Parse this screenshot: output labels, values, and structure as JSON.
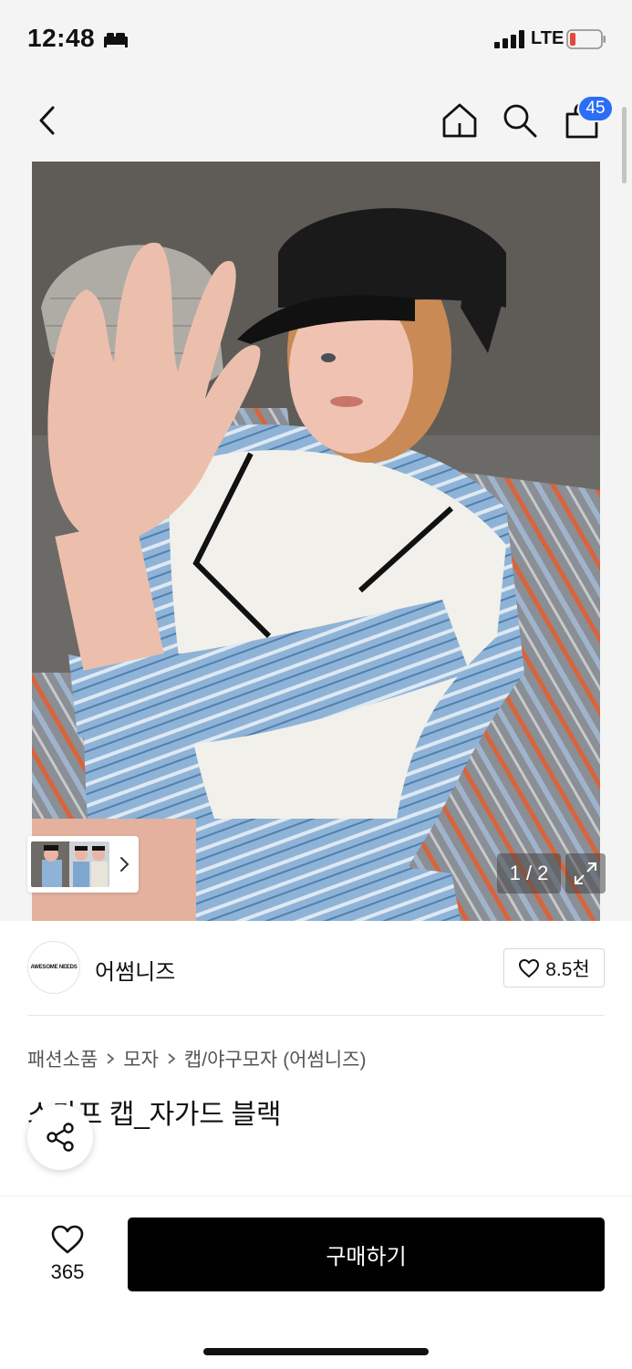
{
  "status_bar": {
    "time": "12:48",
    "network": "LTE",
    "icons": [
      "sleep-icon",
      "signal-icon",
      "battery-low-icon"
    ]
  },
  "header": {
    "icons": [
      "back-arrow-icon",
      "home-icon",
      "search-icon",
      "shopping-bag-icon"
    ],
    "cart_count": "45"
  },
  "gallery": {
    "page_indicator": "1 / 2",
    "icons": [
      "expand-icon",
      "chevron-right-icon"
    ]
  },
  "brand": {
    "logo_text": "AWESOME NEEDS",
    "name": "어썸니즈",
    "like_count": "8.5천"
  },
  "breadcrumb": [
    "패션소품",
    "모자",
    "캡/야구모자 (어썸니즈)"
  ],
  "product": {
    "title": "스카프 캡_자가드 블랙"
  },
  "bottom_bar": {
    "like_count": "365",
    "buy_label": "구매하기"
  },
  "colors": {
    "accent_badge": "#2b6ef5",
    "buy_button": "#000000",
    "header_bg": "#f4f4f4"
  }
}
